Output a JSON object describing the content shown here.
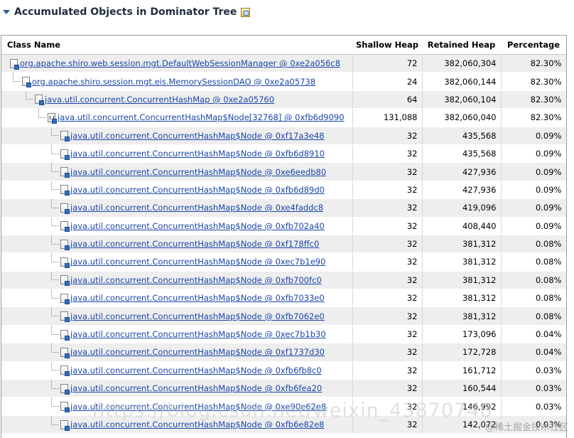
{
  "header": {
    "title": "Accumulated Objects in Dominator Tree"
  },
  "columns": {
    "name": "Class Name",
    "shallow": "Shallow Heap",
    "retained": "Retained Heap",
    "percentage": "Percentage"
  },
  "rows": [
    {
      "depth": 0,
      "icon": "object",
      "name": "org.apache.shiro.web.session.mgt.DefaultWebSessionManager @ 0xe2a056c8",
      "shallow": "72",
      "retained": "382,060,304",
      "percentage": "82.30%"
    },
    {
      "depth": 1,
      "icon": "object",
      "name": "org.apache.shiro.session.mgt.eis.MemorySessionDAO @ 0xe2a05738",
      "shallow": "24",
      "retained": "382,060,144",
      "percentage": "82.30%"
    },
    {
      "depth": 2,
      "icon": "object",
      "name": "java.util.concurrent.ConcurrentHashMap @ 0xe2a05760",
      "shallow": "64",
      "retained": "382,060,104",
      "percentage": "82.30%"
    },
    {
      "depth": 3,
      "icon": "array",
      "name": "java.util.concurrent.ConcurrentHashMap$Node[32768] @ 0xfb6d9090",
      "shallow": "131,088",
      "retained": "382,060,040",
      "percentage": "82.30%"
    },
    {
      "depth": 4,
      "icon": "object",
      "name": "java.util.concurrent.ConcurrentHashMap$Node @ 0xf17a3e48",
      "shallow": "32",
      "retained": "435,568",
      "percentage": "0.09%"
    },
    {
      "depth": 4,
      "icon": "object",
      "name": "java.util.concurrent.ConcurrentHashMap$Node @ 0xfb6d8910",
      "shallow": "32",
      "retained": "435,568",
      "percentage": "0.09%"
    },
    {
      "depth": 4,
      "icon": "object",
      "name": "java.util.concurrent.ConcurrentHashMap$Node @ 0xe6eedb80",
      "shallow": "32",
      "retained": "427,936",
      "percentage": "0.09%"
    },
    {
      "depth": 4,
      "icon": "object",
      "name": "java.util.concurrent.ConcurrentHashMap$Node @ 0xfb6d89d0",
      "shallow": "32",
      "retained": "427,936",
      "percentage": "0.09%"
    },
    {
      "depth": 4,
      "icon": "object",
      "name": "java.util.concurrent.ConcurrentHashMap$Node @ 0xe4faddc8",
      "shallow": "32",
      "retained": "419,096",
      "percentage": "0.09%"
    },
    {
      "depth": 4,
      "icon": "object",
      "name": "java.util.concurrent.ConcurrentHashMap$Node @ 0xfb702a40",
      "shallow": "32",
      "retained": "408,440",
      "percentage": "0.09%"
    },
    {
      "depth": 4,
      "icon": "object",
      "name": "java.util.concurrent.ConcurrentHashMap$Node @ 0xf178ffc0",
      "shallow": "32",
      "retained": "381,312",
      "percentage": "0.08%"
    },
    {
      "depth": 4,
      "icon": "object",
      "name": "java.util.concurrent.ConcurrentHashMap$Node @ 0xec7b1e90",
      "shallow": "32",
      "retained": "381,312",
      "percentage": "0.08%"
    },
    {
      "depth": 4,
      "icon": "object",
      "name": "java.util.concurrent.ConcurrentHashMap$Node @ 0xfb700fc0",
      "shallow": "32",
      "retained": "381,312",
      "percentage": "0.08%"
    },
    {
      "depth": 4,
      "icon": "object",
      "name": "java.util.concurrent.ConcurrentHashMap$Node @ 0xfb7033e0",
      "shallow": "32",
      "retained": "381,312",
      "percentage": "0.08%"
    },
    {
      "depth": 4,
      "icon": "object",
      "name": "java.util.concurrent.ConcurrentHashMap$Node @ 0xfb7062e0",
      "shallow": "32",
      "retained": "381,312",
      "percentage": "0.08%"
    },
    {
      "depth": 4,
      "icon": "object",
      "name": "java.util.concurrent.ConcurrentHashMap$Node @ 0xec7b1b30",
      "shallow": "32",
      "retained": "173,096",
      "percentage": "0.04%"
    },
    {
      "depth": 4,
      "icon": "object",
      "name": "java.util.concurrent.ConcurrentHashMap$Node @ 0xf1737d30",
      "shallow": "32",
      "retained": "172,728",
      "percentage": "0.04%"
    },
    {
      "depth": 4,
      "icon": "object",
      "name": "java.util.concurrent.ConcurrentHashMap$Node @ 0xfb6fb8c0",
      "shallow": "32",
      "retained": "161,712",
      "percentage": "0.03%"
    },
    {
      "depth": 4,
      "icon": "object",
      "name": "java.util.concurrent.ConcurrentHashMap$Node @ 0xfb6fea20",
      "shallow": "32",
      "retained": "160,544",
      "percentage": "0.03%"
    },
    {
      "depth": 4,
      "icon": "object",
      "name": "java.util.concurrent.ConcurrentHashMap$Node @ 0xe90e62e8",
      "shallow": "32",
      "retained": "146,992",
      "percentage": "0.03%"
    },
    {
      "depth": 4,
      "icon": "object",
      "name": "java.util.concurrent.ConcurrentHashMap$Node @ 0xfb6e82e8",
      "shallow": "32",
      "retained": "142,072",
      "percentage": "0.03%"
    }
  ],
  "watermark": {
    "url": "https://blog.csdn.net/weixin_43870748",
    "brand": "@稀土掘金技术社区"
  },
  "icons": {
    "header": "report-icon",
    "collapse": "collapse-triangle-icon",
    "object": "object-icon",
    "array": "array-icon"
  },
  "colors": {
    "link": "#1b46a8",
    "row_alt": "#eeeeee",
    "title": "#1f2d3d"
  }
}
